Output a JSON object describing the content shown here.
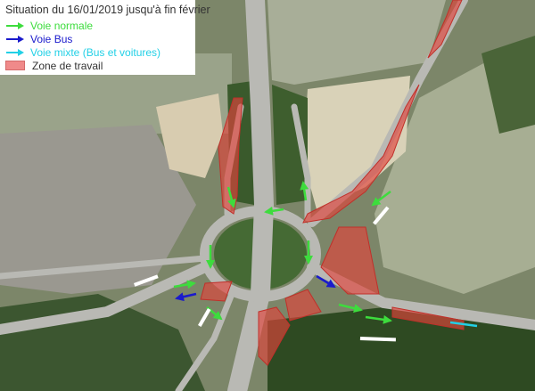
{
  "legend": {
    "title": "Situation du 16/01/2019 jusqu'à fin février",
    "items": [
      {
        "label": "Voie normale",
        "color": "#3ddc3d",
        "kind": "arrow"
      },
      {
        "label": "Voie Bus",
        "color": "#1a1acc",
        "kind": "arrow"
      },
      {
        "label": "Voie mixte (Bus et voitures)",
        "color": "#22d0e6",
        "kind": "arrow"
      },
      {
        "label": "Zone de travail",
        "color": "#f08a8a",
        "kind": "area"
      }
    ]
  },
  "map_colors": {
    "normal_lane": "#3ddc3d",
    "bus_lane": "#1a1acc",
    "mixed_lane": "#22d0e6",
    "work_zone": "#e0443c"
  }
}
